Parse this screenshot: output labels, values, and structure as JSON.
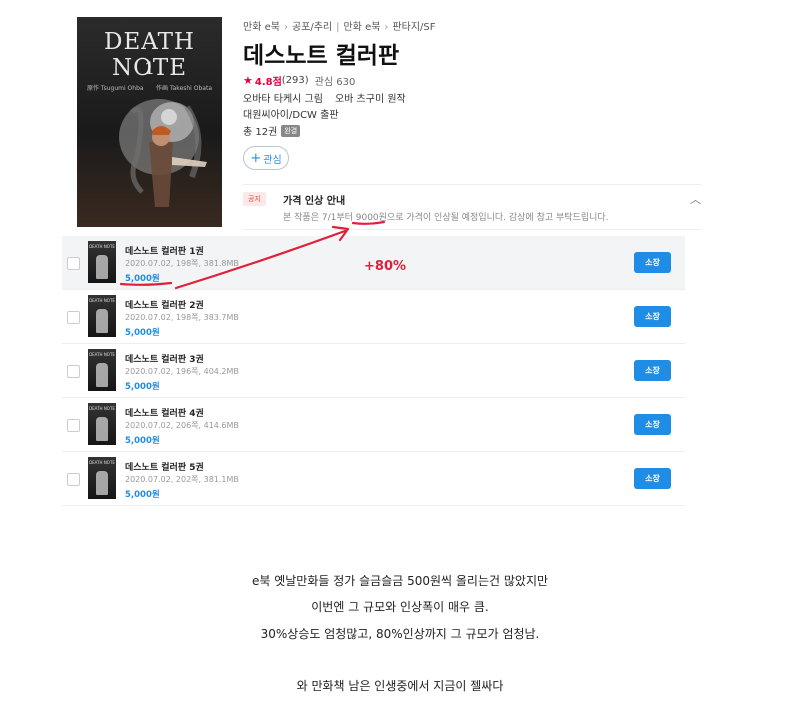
{
  "cover": {
    "title": "DEATH NOTE",
    "volume": "1",
    "author_left": "原作 Tsugumi Ohba",
    "author_right": "作画 Takeshi Obata"
  },
  "breadcrumb": [
    "만화 e북",
    "공포/추리",
    "만화 e북",
    "판타지/SF"
  ],
  "title": "데스노트 컬러판",
  "rating": {
    "score": "4.8점",
    "count": "(293)",
    "interest": "관심 630"
  },
  "credits": {
    "artist": "오바타 타케시 그림",
    "writer": "오바 츠구미 원작",
    "publisher": "대원씨아이/DCW 출판"
  },
  "volumes": {
    "label": "총 12권",
    "complete_badge": "완결"
  },
  "fav_button": {
    "label": "관심"
  },
  "notice": {
    "tag": "공지",
    "title": "가격 인상 안내",
    "body": "본 작품은 7/1부터 9000원으로 가격이 인상될 예정입니다. 감상에 참고 부탁드립니다."
  },
  "annotation": {
    "increase": "+80%"
  },
  "rows": [
    {
      "title": "데스노트 컬러판 1권",
      "meta": "2020.07.02, 198쪽, 381.8MB",
      "price": "5,000원",
      "button": "소장"
    },
    {
      "title": "데스노트 컬러판 2권",
      "meta": "2020.07.02, 198쪽, 383.7MB",
      "price": "5,000원",
      "button": "소장"
    },
    {
      "title": "데스노트 컬러판 3권",
      "meta": "2020.07.02, 196쪽, 404.2MB",
      "price": "5,000원",
      "button": "소장"
    },
    {
      "title": "데스노트 컬러판 4권",
      "meta": "2020.07.02, 206쪽, 414.6MB",
      "price": "5,000원",
      "button": "소장"
    },
    {
      "title": "데스노트 컬러판 5권",
      "meta": "2020.07.02, 202쪽, 381.1MB",
      "price": "5,000원",
      "button": "소장"
    }
  ],
  "captions": [
    "e북 옛날만화들 정가 슬금슬금 500원씩 올리는건 많았지만",
    "이번엔 그 규모와 인상폭이 매우 큼.",
    "30%상승도 엄청많고, 80%인상까지 그 규모가 엄청남.",
    "와 만화책 남은 인생중에서 지금이 젤싸다"
  ],
  "colors": {
    "accent_blue": "#1f8ce6",
    "rating_red": "#e5003b",
    "annotation_red": "#e0203a"
  }
}
